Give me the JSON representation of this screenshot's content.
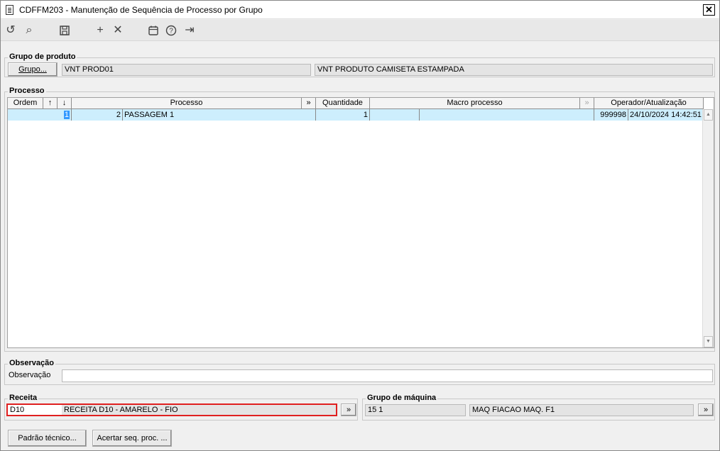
{
  "window": {
    "title": "CDFFM203 - Manutenção de Sequência de Processo por Grupo",
    "close_label": "✕"
  },
  "toolbar": {
    "undo_icon": "↺",
    "search_icon": "⌕",
    "save_icon": "🖫",
    "add_icon": "+",
    "delete_icon": "✕",
    "calendar_icon": "📅",
    "help_icon": "?",
    "exit_icon": "⇥"
  },
  "grupo": {
    "title": "Grupo de produto",
    "button_label": "Grupo...",
    "code": "VNT PROD01",
    "description": "VNT PRODUTO CAMISETA ESTAMPADA"
  },
  "processo": {
    "title": "Processo",
    "columns": {
      "ordem": "Ordem",
      "up": "↑",
      "down": "↓",
      "processo": "Processo",
      "processo_more": "»",
      "quantidade": "Quantidade",
      "macro": "Macro processo",
      "macro_more": "»",
      "operador": "Operador/Atualização"
    },
    "row": {
      "ordem": "1",
      "proc_code": "2",
      "proc_name": "PASSAGEM 1",
      "quantidade": "1",
      "macro_code": "",
      "macro_name": "",
      "operador": "999998",
      "data": "24/10/2024 14:42:51"
    }
  },
  "observacao": {
    "title": "Observação",
    "label": "Observação",
    "value": ""
  },
  "receita": {
    "title": "Receita",
    "code": "D10",
    "description": "RECEITA D10 - AMARELO - FIO",
    "more": "»"
  },
  "maquina": {
    "title": "Grupo de máquina",
    "code": "15 1",
    "description": "MAQ FIACAO MAQ. F1",
    "more": "»"
  },
  "footer": {
    "padrao_label": "Padrão técnico...",
    "acertar_label": "Acertar seq. proc. ..."
  }
}
